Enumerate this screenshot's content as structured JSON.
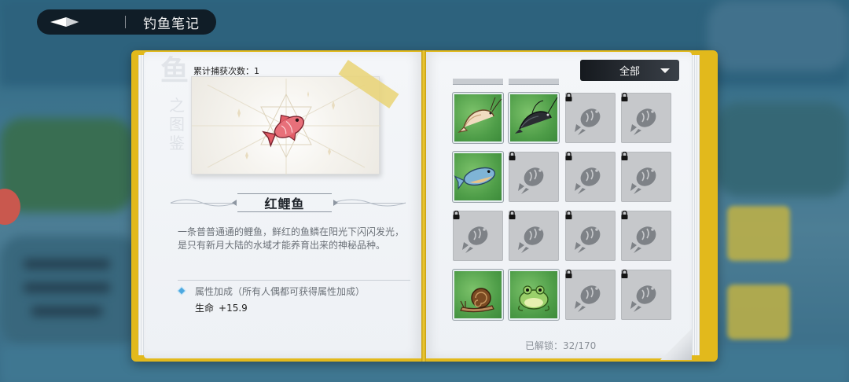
{
  "header": {
    "title": "钓鱼笔记"
  },
  "left_page": {
    "watermark": [
      "鱼",
      "之",
      "图",
      "鉴"
    ],
    "catch_count": "累计捕获次数：1",
    "fish_name": "红鲤鱼",
    "description": "一条普普通通的鲤鱼，鲜红的鱼鳞在阳光下闪闪发光，是只有新月大陆的水域才能养育出来的神秘品种。",
    "attribute_title": "属性加成（所有人偶都可获得属性加成）",
    "attribute_stat": "生命",
    "attribute_value": "+15.9"
  },
  "right_page": {
    "filter": "全部",
    "unlock_status": "已解锁：32/170",
    "grid": [
      [
        {
          "state": "unlocked",
          "icon": "shrimp-icon"
        },
        {
          "state": "unlocked",
          "icon": "black-shrimp-icon"
        },
        {
          "state": "locked",
          "icon": "fish-silhouette-icon"
        },
        {
          "state": "locked",
          "icon": "fish-silhouette-icon"
        }
      ],
      [
        {
          "state": "unlocked",
          "icon": "blue-fish-icon"
        },
        {
          "state": "locked",
          "icon": "fish-silhouette-icon"
        },
        {
          "state": "locked",
          "icon": "fish-silhouette-icon"
        },
        {
          "state": "locked",
          "icon": "fish-silhouette-icon"
        }
      ],
      [
        {
          "state": "locked",
          "icon": "fish-silhouette-icon"
        },
        {
          "state": "locked",
          "icon": "fish-silhouette-icon"
        },
        {
          "state": "locked",
          "icon": "fish-silhouette-icon"
        },
        {
          "state": "locked",
          "icon": "fish-silhouette-icon"
        }
      ],
      [
        {
          "state": "unlocked",
          "icon": "snail-icon"
        },
        {
          "state": "unlocked",
          "icon": "frog-icon"
        },
        {
          "state": "locked",
          "icon": "fish-silhouette-icon"
        },
        {
          "state": "locked",
          "icon": "fish-silhouette-icon"
        }
      ]
    ]
  },
  "colors": {
    "book_cover": "#e2b91c",
    "unlocked_bg": "#4e9d48",
    "locked_bg": "#c6c8cb",
    "accent_blue": "#4da8e0"
  }
}
